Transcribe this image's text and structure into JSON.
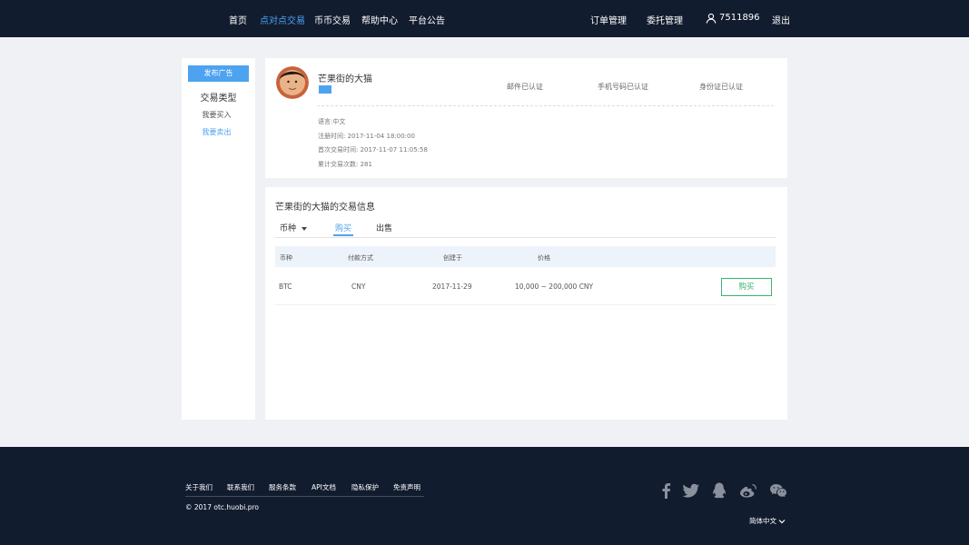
{
  "nav": {
    "items": [
      "首页",
      "点对点交易",
      "币币交易",
      "帮助中心",
      "平台公告"
    ],
    "active_index": 1,
    "order_manage": "订单管理",
    "entrust_manage": "委托管理",
    "user_id": "7511896",
    "logout": "退出"
  },
  "sidebar": {
    "post_ad": "发布广告",
    "title": "交易类型",
    "links": [
      "我要买入",
      "我要卖出"
    ],
    "active_index": 1
  },
  "profile": {
    "username": "芒果街的大猫",
    "verifications": [
      "邮件已认证",
      "手机号码已认证",
      "身份证已认证"
    ],
    "meta": [
      "语言:中文",
      "注册时间: 2017-11-04 18:00:00",
      "首次交易时间: 2017-11-07 11:05:58",
      "累计交易次数: 281"
    ]
  },
  "trade": {
    "title": "芒果街的大猫的交易信息",
    "tabs": [
      "币种",
      "购买",
      "出售"
    ],
    "active_tab": 1,
    "columns": [
      "币种",
      "付款方式",
      "创建于",
      "价格"
    ],
    "rows": [
      {
        "coin": "BTC",
        "payment": "CNY",
        "created": "2017-11-29",
        "price": "10,000 ~ 200,000 CNY",
        "action": "购买"
      }
    ]
  },
  "footer": {
    "links": [
      "关于我们",
      "联系我们",
      "服务条款",
      "API文档",
      "隐私保护",
      "免责声明"
    ],
    "copyright": "© 2017 otc.huobi.pro",
    "social": [
      "facebook-icon",
      "twitter-icon",
      "qq-icon",
      "weibo-icon",
      "wechat-icon"
    ],
    "language": "简体中文"
  },
  "colors": {
    "header_bg": "#121c2f",
    "accent": "#4da3f0",
    "buy_green": "#3cb371",
    "page_bg": "#f0f1f4"
  }
}
